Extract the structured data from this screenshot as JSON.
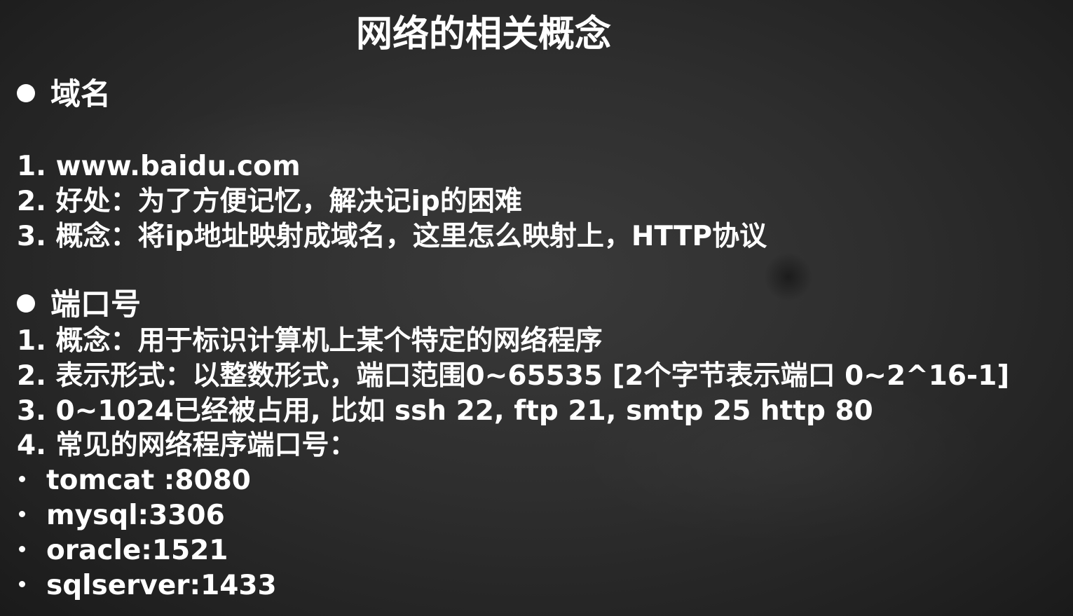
{
  "title": "网络的相关概念",
  "domain_section": {
    "heading": "域名",
    "items": [
      "1. www.baidu.com",
      "2. 好处：为了方便记忆，解决记ip的困难",
      "3. 概念：将ip地址映射成域名，这里怎么映射上，HTTP协议"
    ]
  },
  "port_section": {
    "heading": "端口号",
    "items": [
      "1. 概念：用于标识计算机上某个特定的网络程序",
      "2. 表示形式：以整数形式，端口范围0~65535 [2个字节表示端口 0~2^16-1]",
      "3. 0~1024已经被占用, 比如 ssh 22, ftp 21, smtp 25  http 80",
      "4. 常见的网络程序端口号："
    ],
    "common_ports": [
      "tomcat :8080",
      "mysql:3306",
      "oracle:1521",
      "sqlserver:1433"
    ]
  }
}
